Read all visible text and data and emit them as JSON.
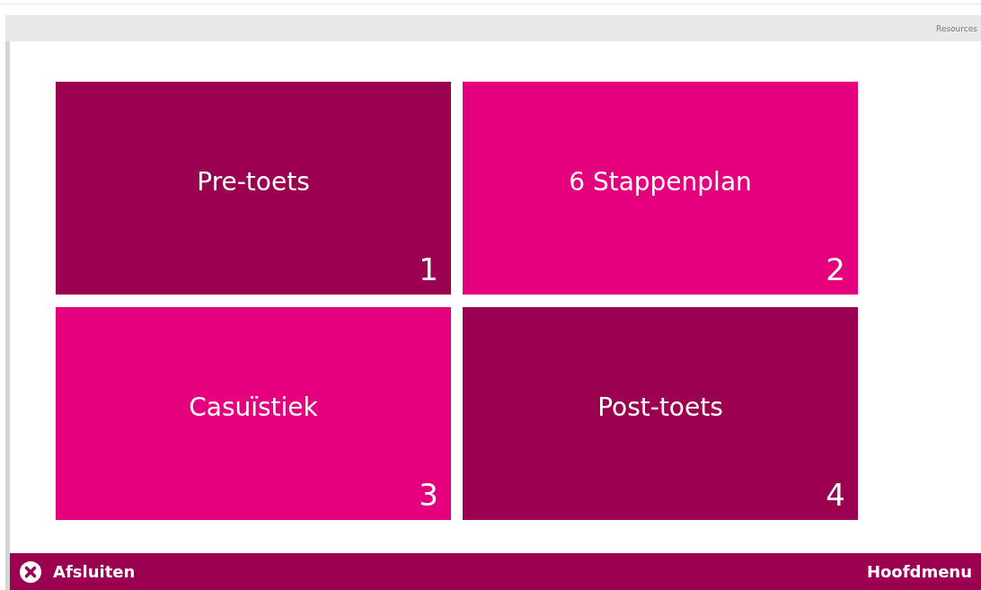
{
  "header": {
    "link": "Resources"
  },
  "tiles": [
    {
      "title": "Pre-toets",
      "number": "1",
      "color": "#9b0051"
    },
    {
      "title": "6 Stappenplan",
      "number": "2",
      "color": "#e5007e"
    },
    {
      "title": "Casuïstiek",
      "number": "3",
      "color": "#e5007e"
    },
    {
      "title": "Post-toets",
      "number": "4",
      "color": "#9b0051"
    }
  ],
  "footer": {
    "close": "Afsluiten",
    "menu": "Hoofdmenu"
  }
}
